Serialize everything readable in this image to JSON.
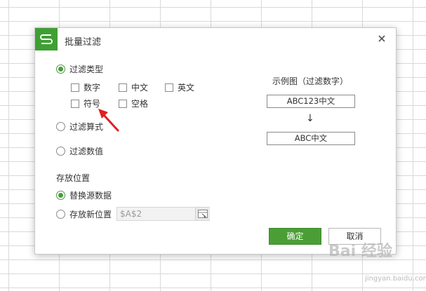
{
  "dialog": {
    "title": "批量过滤",
    "filter_type": {
      "label": "过滤类型",
      "options": {
        "digits": "数字",
        "chinese": "中文",
        "english": "英文",
        "symbols": "符号",
        "spaces": "空格"
      }
    },
    "filter_formula": {
      "label": "过滤算式"
    },
    "filter_value": {
      "label": "过滤数值"
    },
    "example": {
      "title": "示例图（过滤数字）",
      "before": "ABC123中文",
      "arrow": "↓",
      "after": "ABC中文"
    },
    "storage": {
      "label": "存放位置",
      "replace_source": "替换源数据",
      "new_location": "存放新位置",
      "new_location_value": "$A$2"
    },
    "ok_label": "确定",
    "cancel_label": "取消"
  },
  "watermark": {
    "text": "Bai 经验",
    "sub": "jingyan.baidu.com"
  },
  "colors": {
    "accent": "#4b9e35",
    "annotation_arrow": "#e02020"
  },
  "icons": [
    "wps-logo-icon",
    "close-icon",
    "range-select-icon",
    "down-arrow-icon",
    "annotation-arrow-icon"
  ]
}
